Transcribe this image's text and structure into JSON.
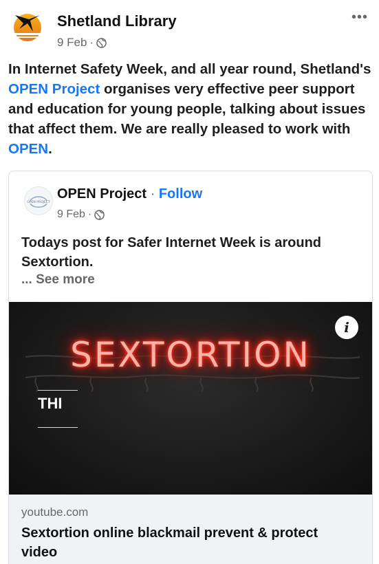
{
  "post": {
    "author": "Shetland Library",
    "date": "9 Feb",
    "separator": "·",
    "more": "•••",
    "text_part1": "In Internet Safety Week, and all year round, Shetland's ",
    "link1": "OPEN Project",
    "text_part2": " organises very effective peer support and education for young people, talking about issues that affect them. We are really pleased to work with ",
    "link2": "OPEN",
    "text_part3": "."
  },
  "shared": {
    "author": "OPEN Project",
    "dot": " · ",
    "follow": "Follow",
    "date": "9 Feb",
    "separator": "·",
    "avatar_text": "OPEN PROJECT",
    "text": "Todays post for Safer Internet Week is around Sextortion.",
    "see_more": "... See more"
  },
  "video": {
    "neon_title": "SEXTORTION",
    "label": "THI",
    "info": "i"
  },
  "link_preview": {
    "domain": "youtube.com",
    "title": "Sextortion online blackmail prevent & protect video"
  },
  "colors": {
    "link": "#1877f2",
    "neon": "#ff2a18",
    "secondary_text": "#65676b"
  },
  "icons": [
    "globe-icon",
    "more-icon",
    "info-icon"
  ]
}
